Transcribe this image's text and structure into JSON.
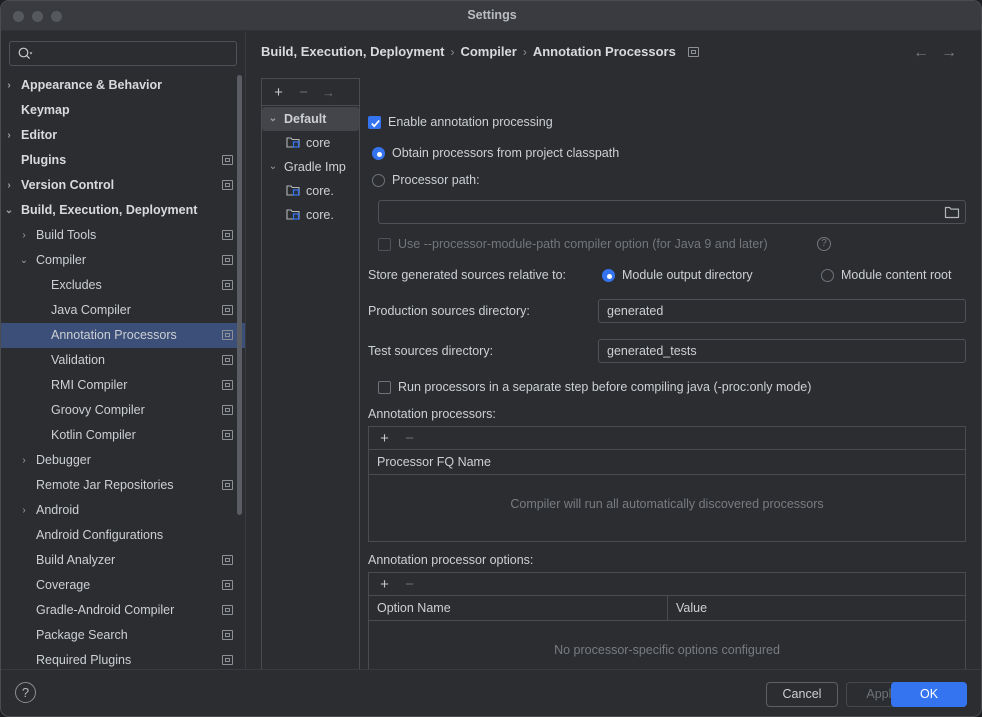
{
  "window": {
    "title": "Settings",
    "traffic_lights": [
      "close",
      "minimize",
      "zoom"
    ]
  },
  "search": {
    "value": "",
    "placeholder": ""
  },
  "sidebar": {
    "items": [
      {
        "label": "Appearance & Behavior",
        "indent": 0,
        "twist": "›",
        "bold": true,
        "badge": false,
        "selected": false
      },
      {
        "label": "Keymap",
        "indent": 0,
        "twist": "",
        "bold": true,
        "badge": false,
        "selected": false
      },
      {
        "label": "Editor",
        "indent": 0,
        "twist": "›",
        "bold": true,
        "badge": false,
        "selected": false
      },
      {
        "label": "Plugins",
        "indent": 0,
        "twist": "",
        "bold": true,
        "badge": true,
        "selected": false
      },
      {
        "label": "Version Control",
        "indent": 0,
        "twist": "›",
        "bold": true,
        "badge": true,
        "selected": false
      },
      {
        "label": "Build, Execution, Deployment",
        "indent": 0,
        "twist": "⌄",
        "bold": true,
        "badge": false,
        "selected": false
      },
      {
        "label": "Build Tools",
        "indent": 1,
        "twist": "›",
        "bold": false,
        "badge": true,
        "selected": false
      },
      {
        "label": "Compiler",
        "indent": 1,
        "twist": "⌄",
        "bold": false,
        "badge": true,
        "selected": false
      },
      {
        "label": "Excludes",
        "indent": 2,
        "twist": "",
        "bold": false,
        "badge": true,
        "selected": false
      },
      {
        "label": "Java Compiler",
        "indent": 2,
        "twist": "",
        "bold": false,
        "badge": true,
        "selected": false
      },
      {
        "label": "Annotation Processors",
        "indent": 2,
        "twist": "",
        "bold": false,
        "badge": true,
        "selected": true
      },
      {
        "label": "Validation",
        "indent": 2,
        "twist": "",
        "bold": false,
        "badge": true,
        "selected": false
      },
      {
        "label": "RMI Compiler",
        "indent": 2,
        "twist": "",
        "bold": false,
        "badge": true,
        "selected": false
      },
      {
        "label": "Groovy Compiler",
        "indent": 2,
        "twist": "",
        "bold": false,
        "badge": true,
        "selected": false
      },
      {
        "label": "Kotlin Compiler",
        "indent": 2,
        "twist": "",
        "bold": false,
        "badge": true,
        "selected": false
      },
      {
        "label": "Debugger",
        "indent": 1,
        "twist": "›",
        "bold": false,
        "badge": false,
        "selected": false
      },
      {
        "label": "Remote Jar Repositories",
        "indent": 1,
        "twist": "",
        "bold": false,
        "badge": true,
        "selected": false
      },
      {
        "label": "Android",
        "indent": 1,
        "twist": "›",
        "bold": false,
        "badge": false,
        "selected": false
      },
      {
        "label": "Android Configurations",
        "indent": 1,
        "twist": "",
        "bold": false,
        "badge": false,
        "selected": false
      },
      {
        "label": "Build Analyzer",
        "indent": 1,
        "twist": "",
        "bold": false,
        "badge": true,
        "selected": false
      },
      {
        "label": "Coverage",
        "indent": 1,
        "twist": "",
        "bold": false,
        "badge": true,
        "selected": false
      },
      {
        "label": "Gradle-Android Compiler",
        "indent": 1,
        "twist": "",
        "bold": false,
        "badge": true,
        "selected": false
      },
      {
        "label": "Package Search",
        "indent": 1,
        "twist": "",
        "bold": false,
        "badge": true,
        "selected": false
      },
      {
        "label": "Required Plugins",
        "indent": 1,
        "twist": "",
        "bold": false,
        "badge": true,
        "selected": false
      }
    ]
  },
  "header": {
    "breadcrumb": [
      "Build, Execution, Deployment",
      "Compiler",
      "Annotation Processors"
    ],
    "separator": "›",
    "back_arrow": "←",
    "forward_arrow": "→"
  },
  "profiles": {
    "toolbar": {
      "add": "+",
      "remove": "−",
      "move": "→"
    },
    "items": [
      {
        "label": "Default",
        "level": 0,
        "twist": "⌄",
        "icon": false,
        "selected": true
      },
      {
        "label": "core",
        "level": 1,
        "twist": "",
        "icon": true,
        "selected": false
      },
      {
        "label": "Gradle Imp",
        "level": 0,
        "twist": "⌄",
        "icon": false,
        "selected": false
      },
      {
        "label": "core.",
        "level": 1,
        "twist": "",
        "icon": true,
        "selected": false
      },
      {
        "label": "core.",
        "level": 1,
        "twist": "",
        "icon": true,
        "selected": false
      }
    ]
  },
  "main": {
    "enable_annotation_processing": {
      "label": "Enable annotation processing",
      "checked": true
    },
    "obtain_from_classpath": {
      "label": "Obtain processors from project classpath",
      "selected": true
    },
    "processor_path": {
      "label": "Processor path:",
      "selected": false,
      "value": "",
      "browse_icon": "folder-icon"
    },
    "module_path_option": {
      "label": "Use --processor-module-path compiler option (for Java 9 and later)",
      "checked": false,
      "disabled": true,
      "help_icon": "?"
    },
    "store_relative": {
      "label": "Store generated sources relative to:",
      "options": [
        {
          "label": "Module output directory",
          "selected": true
        },
        {
          "label": "Module content root",
          "selected": false
        }
      ]
    },
    "production_sources": {
      "label": "Production sources directory:",
      "value": "generated"
    },
    "test_sources": {
      "label": "Test sources directory:",
      "value": "generated_tests"
    },
    "separate_step": {
      "label": "Run processors in a separate step before compiling java (-proc:only mode)",
      "checked": false
    },
    "processors_table": {
      "title": "Annotation processors:",
      "toolbar": {
        "add": "+",
        "remove": "−"
      },
      "columns": [
        "Processor FQ Name"
      ],
      "rows": [],
      "empty_text": "Compiler will run all automatically discovered processors"
    },
    "options_table": {
      "title": "Annotation processor options:",
      "toolbar": {
        "add": "+",
        "remove": "−"
      },
      "columns": [
        "Option Name",
        "Value"
      ],
      "rows": [],
      "empty_text": "No processor-specific options configured"
    }
  },
  "footer": {
    "help": "?",
    "cancel": "Cancel",
    "apply": "Apply",
    "ok": "OK"
  },
  "colors": {
    "accent": "#3574f0",
    "window_bg": "#2b2d30",
    "titlebar_bg": "#393b40",
    "selection": "#3c4f78",
    "text": "#cdd0d4",
    "text_dim": "#787c81",
    "border": "#4a4c50"
  }
}
